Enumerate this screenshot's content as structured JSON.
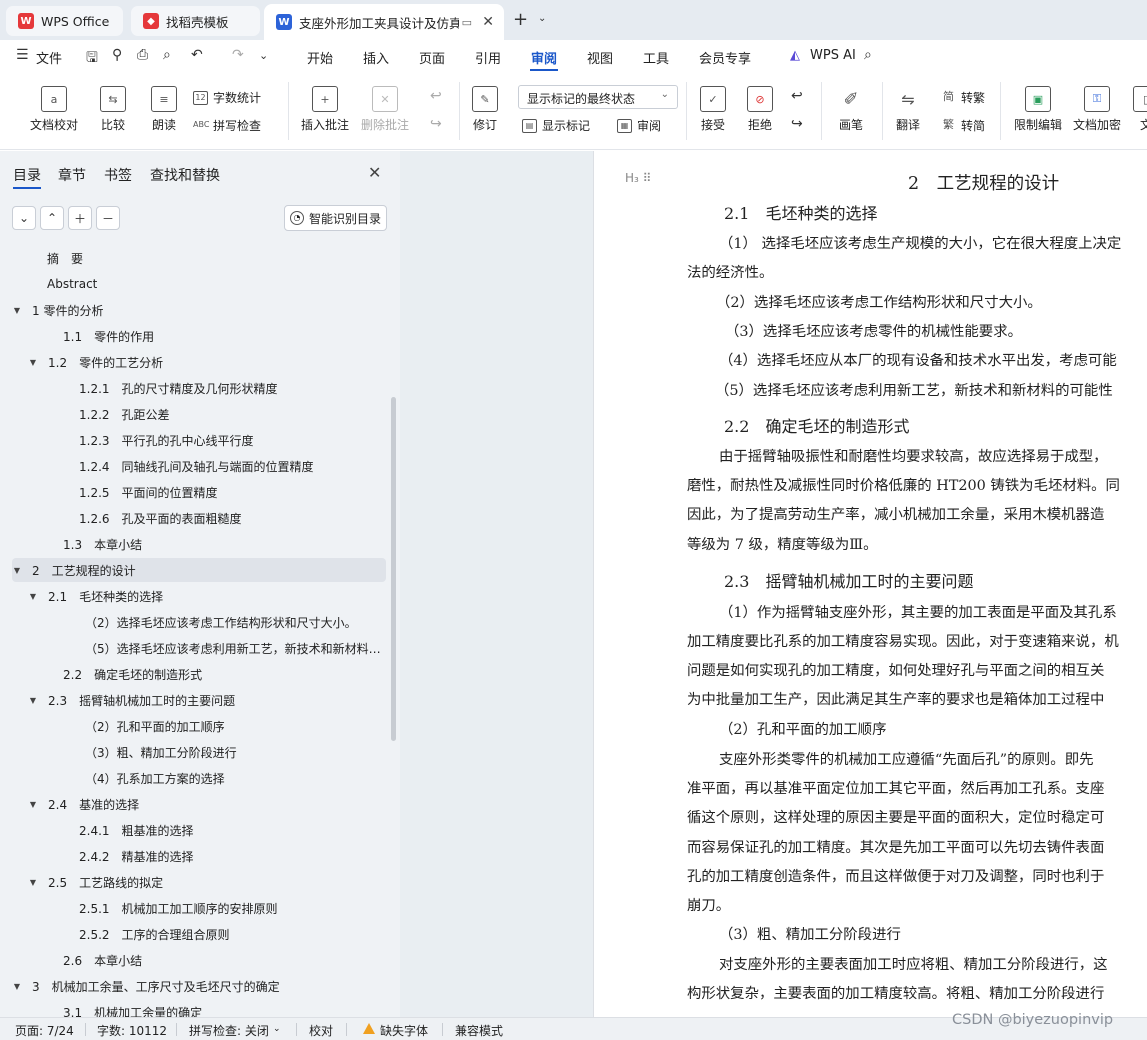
{
  "colors": {
    "accent": "#1a57c9",
    "wps_red": "#e5383b",
    "doc_blue": "#2d63d8"
  },
  "tabs": [
    {
      "label": "WPS Office",
      "icon": "wps-logo-icon"
    },
    {
      "label": "找稻壳模板",
      "icon": "docer-logo-icon"
    },
    {
      "label": "支座外形加工夹具设计及仿真",
      "icon": "writer-doc-icon"
    }
  ],
  "menu": {
    "file": "文件",
    "items": [
      "开始",
      "插入",
      "页面",
      "引用",
      "审阅",
      "视图",
      "工具",
      "会员专享",
      "WPS AI"
    ]
  },
  "ribbon": {
    "doc_check": "文档校对",
    "compare": "比较",
    "read_aloud": "朗读",
    "word_count": "字数统计",
    "spell_check": "拼写检查",
    "insert_comment": "插入批注",
    "delete_comment": "删除批注",
    "revise": "修订",
    "markup_state": "显示标记的最终状态",
    "show_markup": "显示标记",
    "review": "审阅",
    "accept": "接受",
    "reject": "拒绝",
    "pen": "画笔",
    "translate": "翻译",
    "to_traditional": "转繁",
    "to_simplified": "转简",
    "restrict_edit": "限制编辑",
    "encrypt": "文档加密",
    "more": "文"
  },
  "panel": {
    "tabs": [
      "目录",
      "章节",
      "书签",
      "查找和替换"
    ],
    "smart_toc": "智能识别目录",
    "toc": [
      {
        "text": "摘　要",
        "toggle": ""
      },
      {
        "text": "Abstract",
        "toggle": ""
      },
      {
        "text": "1  零件的分析",
        "toggle": "▼"
      },
      {
        "text": "1.1　零件的作用",
        "toggle": ""
      },
      {
        "text": "1.2　零件的工艺分析",
        "toggle": "▼"
      },
      {
        "text": "1.2.1　孔的尺寸精度及几何形状精度",
        "toggle": ""
      },
      {
        "text": "1.2.2　孔距公差",
        "toggle": ""
      },
      {
        "text": "1.2.3　平行孔的孔中心线平行度",
        "toggle": ""
      },
      {
        "text": "1.2.4　同轴线孔间及轴孔与端面的位置精度",
        "toggle": ""
      },
      {
        "text": "1.2.5　平面间的位置精度",
        "toggle": ""
      },
      {
        "text": "1.2.6　孔及平面的表面粗糙度",
        "toggle": ""
      },
      {
        "text": "1.3　本章小结",
        "toggle": ""
      },
      {
        "text": "2　工艺规程的设计",
        "toggle": "▼"
      },
      {
        "text": "2.1　毛坯种类的选择",
        "toggle": "▼"
      },
      {
        "text": "（2）选择毛坯应该考虑工作结构形状和尺寸大小。",
        "toggle": ""
      },
      {
        "text": "（5）选择毛坯应该考虑利用新工艺，新技术和新材料的可能性。",
        "toggle": ""
      },
      {
        "text": "2.2　确定毛坯的制造形式",
        "toggle": ""
      },
      {
        "text": "2.3　摇臂轴机械加工时的主要问题",
        "toggle": "▼"
      },
      {
        "text": "（2）孔和平面的加工顺序",
        "toggle": ""
      },
      {
        "text": "（3）粗、精加工分阶段进行",
        "toggle": ""
      },
      {
        "text": "（4）孔系加工方案的选择",
        "toggle": ""
      },
      {
        "text": "2.4　基准的选择",
        "toggle": "▼"
      },
      {
        "text": "2.4.1　粗基准的选择",
        "toggle": ""
      },
      {
        "text": "2.4.2　精基准的选择",
        "toggle": ""
      },
      {
        "text": "2.5　工艺路线的拟定",
        "toggle": "▼"
      },
      {
        "text": "2.5.1　机械加工加工顺序的安排原则",
        "toggle": ""
      },
      {
        "text": "2.5.2　工序的合理组合原则",
        "toggle": ""
      },
      {
        "text": "2.6　本章小结",
        "toggle": ""
      },
      {
        "text": "3　机械加工余量、工序尺寸及毛坯尺寸的确定",
        "toggle": "▼"
      },
      {
        "text": "3.1　机械加工余量的确定",
        "toggle": ""
      }
    ]
  },
  "document": {
    "heading_marker": "H₃ ⠿",
    "title": "2　工艺规程的设计",
    "headings": [
      "2.1　毛坯种类的选择",
      "2.2　确定毛坯的制造形式",
      "2.3　摇臂轴机械加工时的主要问题"
    ],
    "lines": [
      "（1） 选择毛坯应该考虑生产规模的大小，它在很大程度上决定",
      "法的经济性。",
      "（2）选择毛坯应该考虑工作结构形状和尺寸大小。",
      "（3）选择毛坯应该考虑零件的机械性能要求。",
      "（4）选择毛坯应从本厂的现有设备和技术水平出发，考虑可能",
      "（5）选择毛坯应该考虑利用新工艺，新技术和新材料的可能性",
      "由于摇臂轴吸振性和耐磨性均要求较高，故应选择易于成型，",
      "磨性，耐热性及减振性同时价格低廉的 HT200 铸铁为毛坯材料。同",
      "因此，为了提高劳动生产率，减小机械加工余量，采用木模机器造",
      "等级为 7 级，精度等级为Ⅲ。",
      "（1）作为摇臂轴支座外形，其主要的加工表面是平面及其孔系",
      "加工精度要比孔系的加工精度容易实现。因此，对于变速箱来说，机",
      "问题是如何实现孔的加工精度，如何处理好孔与平面之间的相互关",
      "为中批量加工生产，因此满足其生产率的要求也是箱体加工过程中",
      "（2）孔和平面的加工顺序",
      "支座外形类零件的机械加工应遵循“先面后孔”的原则。即先",
      "准平面，再以基准平面定位加工其它平面，然后再加工孔系。支座",
      "循这个原则，这样处理的原因主要是平面的面积大，定位时稳定可",
      "而容易保证孔的加工精度。其次是先加工平面可以先切去铸件表面",
      "孔的加工精度创造条件，而且这样做便于对刀及调整，同时也利于",
      "崩刀。",
      "（3）粗、精加工分阶段进行",
      "对支座外形的主要表面加工时应将粗、精加工分阶段进行，这",
      "构形状复杂，主要表面的加工精度较高。将粗、精加工分阶段进行"
    ]
  },
  "status": {
    "page": "页面: 7/24",
    "words": "字数: 10112",
    "spell": "拼写检查: 关闭",
    "proof": "校对",
    "missing_font": "缺失字体",
    "compat": "兼容模式"
  },
  "watermark": "CSDN @biyezuopinvip"
}
